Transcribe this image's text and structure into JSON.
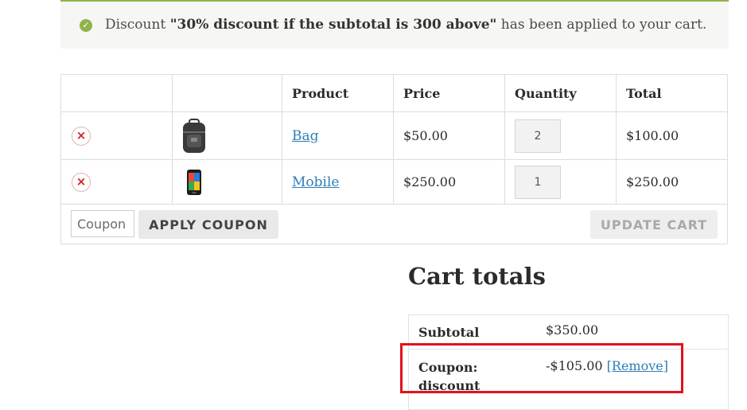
{
  "notice": {
    "prefix": "Discount ",
    "discount_name": "\"30% discount if the subtotal is 300 above\"",
    "suffix": " has been applied to your cart.",
    "icon": "check-circle-icon",
    "color": "#8fb44a"
  },
  "cart": {
    "columns": [
      "",
      "",
      "Product",
      "Price",
      "Quantity",
      "Total"
    ],
    "rows": [
      {
        "remove_symbol": "×",
        "image_icon": "backpack-icon",
        "product": "Bag",
        "price": "$50.00",
        "quantity": "2",
        "total": "$100.00"
      },
      {
        "remove_symbol": "×",
        "image_icon": "smartphone-icon",
        "product": "Mobile",
        "price": "$250.00",
        "quantity": "1",
        "total": "$250.00"
      }
    ],
    "coupon_placeholder": "Coupon",
    "apply_coupon_label": "APPLY COUPON",
    "update_cart_label": "UPDATE CART"
  },
  "totals": {
    "title": "Cart totals",
    "subtotal_label": "Subtotal",
    "subtotal_value": "$350.00",
    "coupon_label_line1": "Coupon:",
    "coupon_label_line2": "discount",
    "coupon_value": "-$105.00",
    "remove_link": "[Remove]",
    "highlight_color": "#e0121b"
  }
}
